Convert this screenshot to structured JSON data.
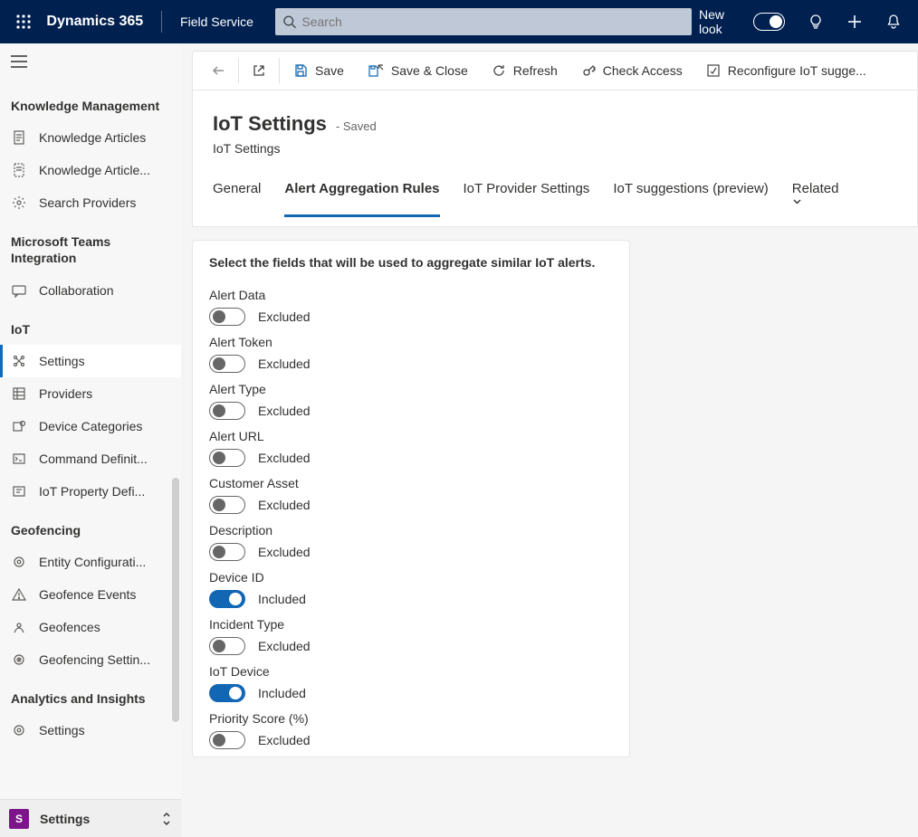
{
  "header": {
    "brand": "Dynamics 365",
    "app_name": "Field Service",
    "search_placeholder": "Search",
    "new_look_label": "New look"
  },
  "sidebar": {
    "groups": [
      {
        "title": "Knowledge Management",
        "items": [
          {
            "id": "knowledge-articles",
            "label": "Knowledge Articles",
            "icon": "doc"
          },
          {
            "id": "knowledge-article-templates",
            "label": "Knowledge Article...",
            "icon": "doc-dashed"
          },
          {
            "id": "search-providers",
            "label": "Search Providers",
            "icon": "gear"
          }
        ]
      },
      {
        "title": "Microsoft Teams Integration",
        "items": [
          {
            "id": "collaboration",
            "label": "Collaboration",
            "icon": "chat"
          }
        ]
      },
      {
        "title": "IoT",
        "items": [
          {
            "id": "iot-settings",
            "label": "Settings",
            "icon": "iot",
            "selected": true
          },
          {
            "id": "providers",
            "label": "Providers",
            "icon": "grid"
          },
          {
            "id": "device-categories",
            "label": "Device Categories",
            "icon": "device"
          },
          {
            "id": "command-definitions",
            "label": "Command Definit...",
            "icon": "cmd"
          },
          {
            "id": "iot-property-definitions",
            "label": "IoT Property Defi...",
            "icon": "prop"
          }
        ]
      },
      {
        "title": "Geofencing",
        "items": [
          {
            "id": "entity-config",
            "label": "Entity Configurati...",
            "icon": "gear2"
          },
          {
            "id": "geofence-events",
            "label": "Geofence Events",
            "icon": "warn"
          },
          {
            "id": "geofences",
            "label": "Geofences",
            "icon": "geo"
          },
          {
            "id": "geofencing-settings",
            "label": "Geofencing Settin...",
            "icon": "gear-eye"
          }
        ]
      },
      {
        "title": "Analytics and Insights",
        "items": [
          {
            "id": "ai-settings",
            "label": "Settings",
            "icon": "gear2"
          }
        ]
      }
    ]
  },
  "app_switcher": {
    "tile_letter": "S",
    "label": "Settings"
  },
  "commands": {
    "save": "Save",
    "save_close": "Save & Close",
    "refresh": "Refresh",
    "check_access": "Check Access",
    "reconfigure": "Reconfigure IoT sugge..."
  },
  "page": {
    "title": "IoT Settings",
    "saved_tag": "- Saved",
    "subtitle": "IoT Settings",
    "tabs": [
      {
        "id": "general",
        "label": "General"
      },
      {
        "id": "agg-rules",
        "label": "Alert Aggregation Rules",
        "active": true
      },
      {
        "id": "provider",
        "label": "IoT Provider Settings"
      },
      {
        "id": "suggestions",
        "label": "IoT suggestions (preview)"
      },
      {
        "id": "related",
        "label": "Related",
        "dropdown": true
      }
    ]
  },
  "panel": {
    "title": "Select the fields that will be used to aggregate similar IoT alerts.",
    "state_on": "Included",
    "state_off": "Excluded",
    "fields": [
      {
        "id": "alert-data",
        "label": "Alert Data",
        "on": false
      },
      {
        "id": "alert-token",
        "label": "Alert Token",
        "on": false
      },
      {
        "id": "alert-type",
        "label": "Alert Type",
        "on": false
      },
      {
        "id": "alert-url",
        "label": "Alert URL",
        "on": false
      },
      {
        "id": "customer-asset",
        "label": "Customer Asset",
        "on": false
      },
      {
        "id": "description",
        "label": "Description",
        "on": false
      },
      {
        "id": "device-id",
        "label": "Device ID",
        "on": true
      },
      {
        "id": "incident-type",
        "label": "Incident Type",
        "on": false
      },
      {
        "id": "iot-device",
        "label": "IoT Device",
        "on": true
      },
      {
        "id": "priority-score",
        "label": "Priority Score (%)",
        "on": false
      }
    ]
  }
}
